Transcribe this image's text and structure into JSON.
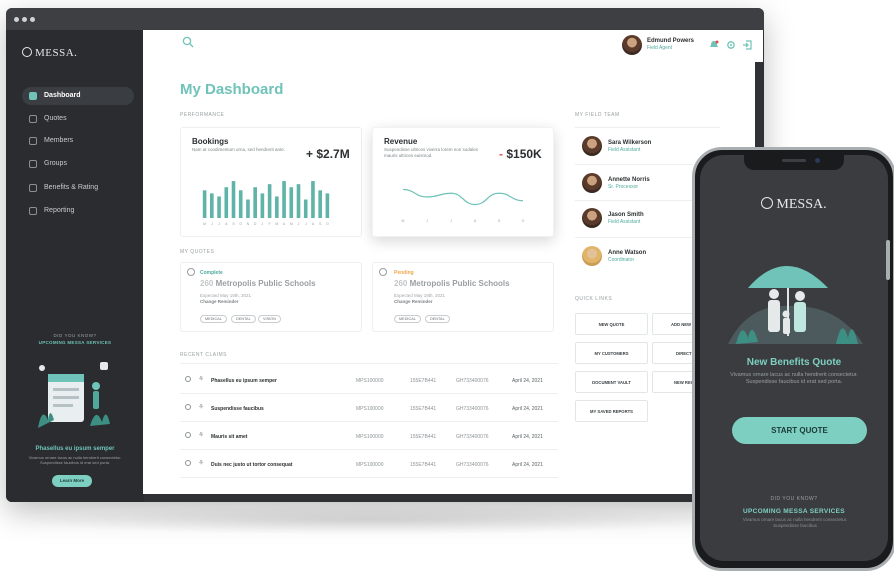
{
  "app": {
    "logo": "MESSA."
  },
  "sidebar": {
    "items": [
      {
        "label": "Dashboard",
        "icon": "home-icon",
        "active": true
      },
      {
        "label": "Quotes",
        "icon": "quotes-icon"
      },
      {
        "label": "Members",
        "icon": "members-icon"
      },
      {
        "label": "Groups",
        "icon": "groups-icon"
      },
      {
        "label": "Benefits & Rating",
        "icon": "benefits-icon"
      },
      {
        "label": "Reporting",
        "icon": "reporting-icon"
      }
    ],
    "did_you_know": "DID YOU KNOW?",
    "upcoming": "UPCOMING MESSA SERVICES",
    "promo_title": "Phasellus eu ipsum semper",
    "promo_text": "Vivamus ornare lacus ac nulla hendrerit consectetur. Suspendisse faucibus id erat sed porta.",
    "learn_more": "Learn More"
  },
  "header": {
    "user_name": "Edmund Powers",
    "user_role": "Field Agent"
  },
  "dashboard": {
    "title": "My Dashboard",
    "performance_label": "PERFORMANCE",
    "bookings": {
      "title": "Bookings",
      "text": "Nam at condimentum urna, sed hendrerit ante.",
      "value": "+ $2.7M"
    },
    "revenue": {
      "title": "Revenue",
      "text": "Suspendisse ultrices viverra lorem non sodales mauris ultrices euismod.",
      "value": "- $150K"
    },
    "quotes_label": "MY QUOTES",
    "quotes": [
      {
        "status": "Complete",
        "number": "260",
        "name": "Metropolis Public Schools",
        "expected": "Expected May 19th, 2021",
        "reminder": "Change Reminder",
        "tags": [
          "MEDICAL",
          "DENTAL",
          "VISION"
        ]
      },
      {
        "status": "Pending",
        "number": "260",
        "name": "Metropolis Public Schools",
        "expected": "Expected May 19th, 2021",
        "reminder": "Change Reminder",
        "tags": [
          "MEDICAL",
          "DENTAL"
        ]
      }
    ],
    "claims_label": "RECENT CLAIMS",
    "claims": [
      {
        "name": "Phasellus eu ipsum semper",
        "id": "MPS100000",
        "code": "155E7B441",
        "ref": "GH733400076",
        "date": "April 24, 2021"
      },
      {
        "name": "Suspendisse faucibus",
        "id": "MPS100000",
        "code": "155E7B441",
        "ref": "GH733400076",
        "date": "April 24, 2021"
      },
      {
        "name": "Mauris sit amet",
        "id": "MPS100000",
        "code": "155E7B441",
        "ref": "GH733400076",
        "date": "April 24, 2021"
      },
      {
        "name": "Duis nec justo ut tortor consequat",
        "id": "MPS100000",
        "code": "155E7B441",
        "ref": "GH733400076",
        "date": "April 24, 2021"
      }
    ]
  },
  "team": {
    "label": "MY FIELD TEAM",
    "members": [
      {
        "name": "Sara Wilkerson",
        "role": "Field Assistant"
      },
      {
        "name": "Annette Norris",
        "role": "Sr. Processor"
      },
      {
        "name": "Jason Smith",
        "role": "Field Assistant"
      },
      {
        "name": "Anne Watson",
        "role": "Coordinator"
      }
    ]
  },
  "quick_links": {
    "label": "QUICK LINKS",
    "items": [
      "NEW QUOTE",
      "ADD NEW",
      "MY CUSTOMERS",
      "DIRECT",
      "DOCUMENT VAULT",
      "NEW REG",
      "MY SAVED REPORTS"
    ]
  },
  "phone": {
    "logo": "MESSA.",
    "title": "New Benefits Quote",
    "text": "Vivamus ornare lacus ac nulla hendrerit consectetur. Suspendisse faucibus id erat sed porta.",
    "button": "START QUOTE",
    "did_you_know": "DID YOU KNOW?",
    "upcoming": "UPCOMING MESSA SERVICES",
    "small_text": "Vivamus ornare lacus ac nulla hendrerit consectetur. Suspendisse faucibus"
  },
  "chart_data": [
    {
      "type": "bar",
      "title": "Bookings",
      "categories": [
        "M",
        "J",
        "J",
        "A",
        "S",
        "O",
        "N",
        "D",
        "J",
        "F",
        "M",
        "A",
        "M",
        "J",
        "J",
        "A",
        "S",
        "O"
      ],
      "values": [
        9,
        8,
        7,
        10,
        12,
        9,
        6,
        10,
        8,
        11,
        7,
        12,
        10,
        11,
        6,
        12,
        9,
        8
      ],
      "ylim": [
        0,
        13
      ]
    },
    {
      "type": "line",
      "title": "Revenue",
      "categories": [
        "M",
        "J",
        "J",
        "A",
        "S",
        "O"
      ],
      "values": [
        6,
        4,
        5,
        2,
        5,
        3
      ],
      "ylim": [
        0,
        8
      ]
    }
  ],
  "colors": {
    "accent": "#6fc3b8",
    "negative": "#e0524f",
    "pending": "#f0a64a"
  }
}
